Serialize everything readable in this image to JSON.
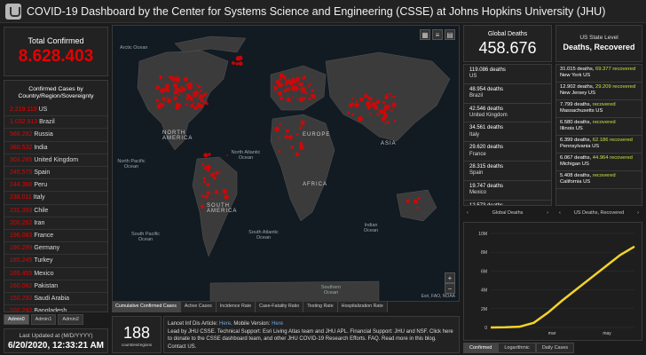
{
  "header": {
    "title": "COVID-19 Dashboard by the Center for Systems Science and Engineering (CSSE) at Johns Hopkins University (JHU)"
  },
  "total": {
    "label": "Total Confirmed",
    "value": "8.628.403"
  },
  "confirmed_list": {
    "header": "Confirmed Cases by Country/Region/Sovereignty",
    "rows": [
      {
        "value": "2.219.119",
        "name": "US"
      },
      {
        "value": "1.032.913",
        "name": "Brazil"
      },
      {
        "value": "568.292",
        "name": "Russia"
      },
      {
        "value": "380.532",
        "name": "India"
      },
      {
        "value": "303.285",
        "name": "United Kingdom"
      },
      {
        "value": "245.575",
        "name": "Spain"
      },
      {
        "value": "244.388",
        "name": "Peru"
      },
      {
        "value": "238.011",
        "name": "Italy"
      },
      {
        "value": "231.393",
        "name": "Chile"
      },
      {
        "value": "200.262",
        "name": "Iran"
      },
      {
        "value": "196.083",
        "name": "France"
      },
      {
        "value": "190.299",
        "name": "Germany"
      },
      {
        "value": "185.245",
        "name": "Turkey"
      },
      {
        "value": "165.455",
        "name": "Mexico"
      },
      {
        "value": "160.082",
        "name": "Pakistan"
      },
      {
        "value": "150.292",
        "name": "Saudi Arabia"
      },
      {
        "value": "102.292",
        "name": "Bangladesh"
      },
      {
        "value": "102.311",
        "name": "Canada"
      }
    ],
    "tabs": [
      "Admin0",
      "Admin1",
      "Admin2"
    ]
  },
  "updated": {
    "label": "Last Updated at (M/D/YYYY)",
    "value": "6/20/2020, 12:33:21 AM"
  },
  "map": {
    "oceans": [
      {
        "text": "Arctic Ocean"
      },
      {
        "text": "North Atlantic Ocean"
      },
      {
        "text": "North Pacific Ocean"
      },
      {
        "text": "South Pacific Ocean"
      },
      {
        "text": "South Atlantic Ocean"
      },
      {
        "text": "Indian Ocean"
      },
      {
        "text": "Southern Ocean"
      }
    ],
    "continents": [
      "NORTH AMERICA",
      "SOUTH AMERICA",
      "EUROPE",
      "AFRICA",
      "ASIA"
    ],
    "attribution": "Esri, FAO, NOAA",
    "tabs": [
      "Cumulative Confirmed Cases",
      "Active Cases",
      "Incidence Rate",
      "Case-Fatality Ratio",
      "Testing Rate",
      "Hospitalization Rate"
    ]
  },
  "countries_count": {
    "value": "188",
    "label": "countries/regions"
  },
  "info": {
    "line1a": "Lancet Inf Dis Article: ",
    "link1": "Here",
    "line1b": ". Mobile Version: ",
    "link2": "Here",
    "line2": "Lead by JHU CSSE. Technical Support: Esri Living Atlas team and JHU APL. Financial Support: JHU and NSF. Click here to donate to the CSSE dashboard team, and other JHU COVID-19 Research Efforts. FAQ. Read more in this blog. Contact US."
  },
  "global_deaths": {
    "label": "Global Deaths",
    "value": "458.676",
    "rows": [
      {
        "v": "119.086 deaths",
        "c": "US"
      },
      {
        "v": "48.954 deaths",
        "c": "Brazil"
      },
      {
        "v": "42.546 deaths",
        "c": "United Kingdom"
      },
      {
        "v": "34.561 deaths",
        "c": "Italy"
      },
      {
        "v": "29.620 deaths",
        "c": "France"
      },
      {
        "v": "28.315 deaths",
        "c": "Spain"
      },
      {
        "v": "19.747 deaths",
        "c": "Mexico"
      },
      {
        "v": "12.573 deaths",
        "c": "India"
      }
    ],
    "pager": "Global Deaths"
  },
  "state_level": {
    "label": "US State Level",
    "big": "Deaths, Recovered",
    "rows": [
      {
        "d": "31.015 deaths",
        "r": "69.377",
        "s": "New York US"
      },
      {
        "d": "12.902 deaths",
        "r": "29.209",
        "s": "New Jersey US"
      },
      {
        "d": "7.799 deaths",
        "r": "",
        "s": "Massachusetts US"
      },
      {
        "d": "6.580 deaths",
        "r": "",
        "s": "Illinois US"
      },
      {
        "d": "6.399 deaths",
        "r": "62.186",
        "s": "Pennsylvania US"
      },
      {
        "d": "6.067 deaths",
        "r": "44.964",
        "s": "Michigan US"
      },
      {
        "d": "5.408 deaths",
        "r": "",
        "s": "California US"
      }
    ],
    "recovered_word": "recovered",
    "pager": "US Deaths, Recovered"
  },
  "chart_data": {
    "type": "line",
    "x": [
      0,
      1,
      2,
      3,
      4,
      5,
      6,
      7,
      8,
      9,
      10
    ],
    "values": [
      0.0,
      0.02,
      0.08,
      0.5,
      1.6,
      2.9,
      4.1,
      5.3,
      6.5,
      7.7,
      8.6
    ],
    "x_ticks": [
      "mar",
      "may"
    ],
    "y_ticks": [
      "0",
      "2M",
      "4M",
      "6M",
      "8M",
      "10M"
    ],
    "ylim": [
      0,
      10
    ],
    "color": "#f5d327"
  },
  "chart_tabs": [
    "Confirmed",
    "Logarithmic",
    "Daily Cases"
  ],
  "colors": {
    "accent": "#e60000",
    "recovered": "#c7e33f",
    "chart": "#f5d327"
  }
}
